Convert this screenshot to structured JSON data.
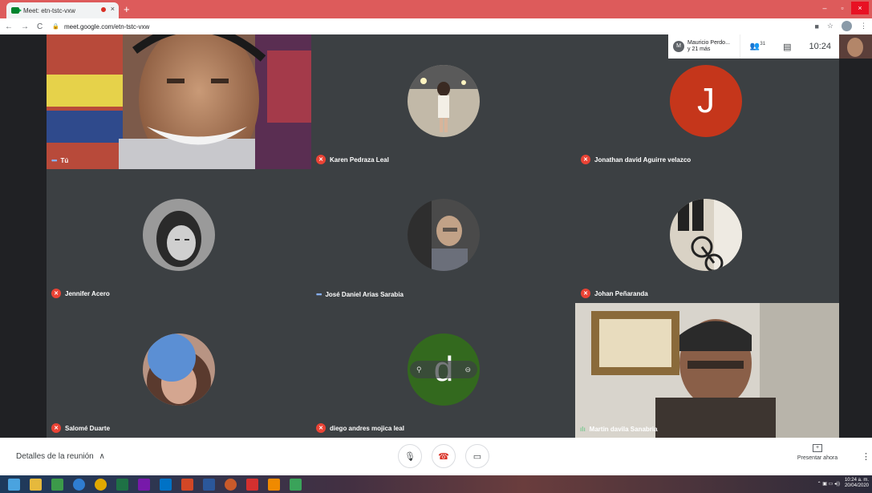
{
  "browser": {
    "tab_title": "Meet: etn-tstc-vxw",
    "new_tab": "+",
    "close_tab": "×",
    "url": "meet.google.com/etn-tstc-vxw",
    "window_controls": {
      "minimize": "–",
      "maximize": "▫",
      "close": "×"
    }
  },
  "meet": {
    "people_card": {
      "initial": "M",
      "line1": "Mauricio Perdo...",
      "line2": "y 21 más"
    },
    "participants_count": "31",
    "clock": "10:24",
    "tiles": [
      {
        "name": "Tú",
        "state": "speaking-dots"
      },
      {
        "name": "Karen Pedraza Leal",
        "state": "muted"
      },
      {
        "name": "Jonathan david Aguirre velazco",
        "state": "muted",
        "initial": "J"
      },
      {
        "name": "Jennifer Acero",
        "state": "muted"
      },
      {
        "name": "José Daniel Arias Sarabia",
        "state": "speaking-dots"
      },
      {
        "name": "Johan Peñaranda",
        "state": "muted"
      },
      {
        "name": "Salomé Duarte",
        "state": "muted"
      },
      {
        "name": "diego andres mojica leal",
        "state": "muted",
        "initial": "d"
      },
      {
        "name": "Martin davila Sanabria",
        "state": "speaking-bars"
      }
    ],
    "bottom": {
      "details_label": "Detalles de la reunión",
      "present_label": "Presentar ahora"
    },
    "colors": {
      "mute_red": "#ea4335",
      "j_avatar": "#c5361b",
      "d_avatar": "#33691e"
    }
  },
  "taskbar": {
    "time": "10:24 a. m.",
    "date": "20/04/2020"
  }
}
